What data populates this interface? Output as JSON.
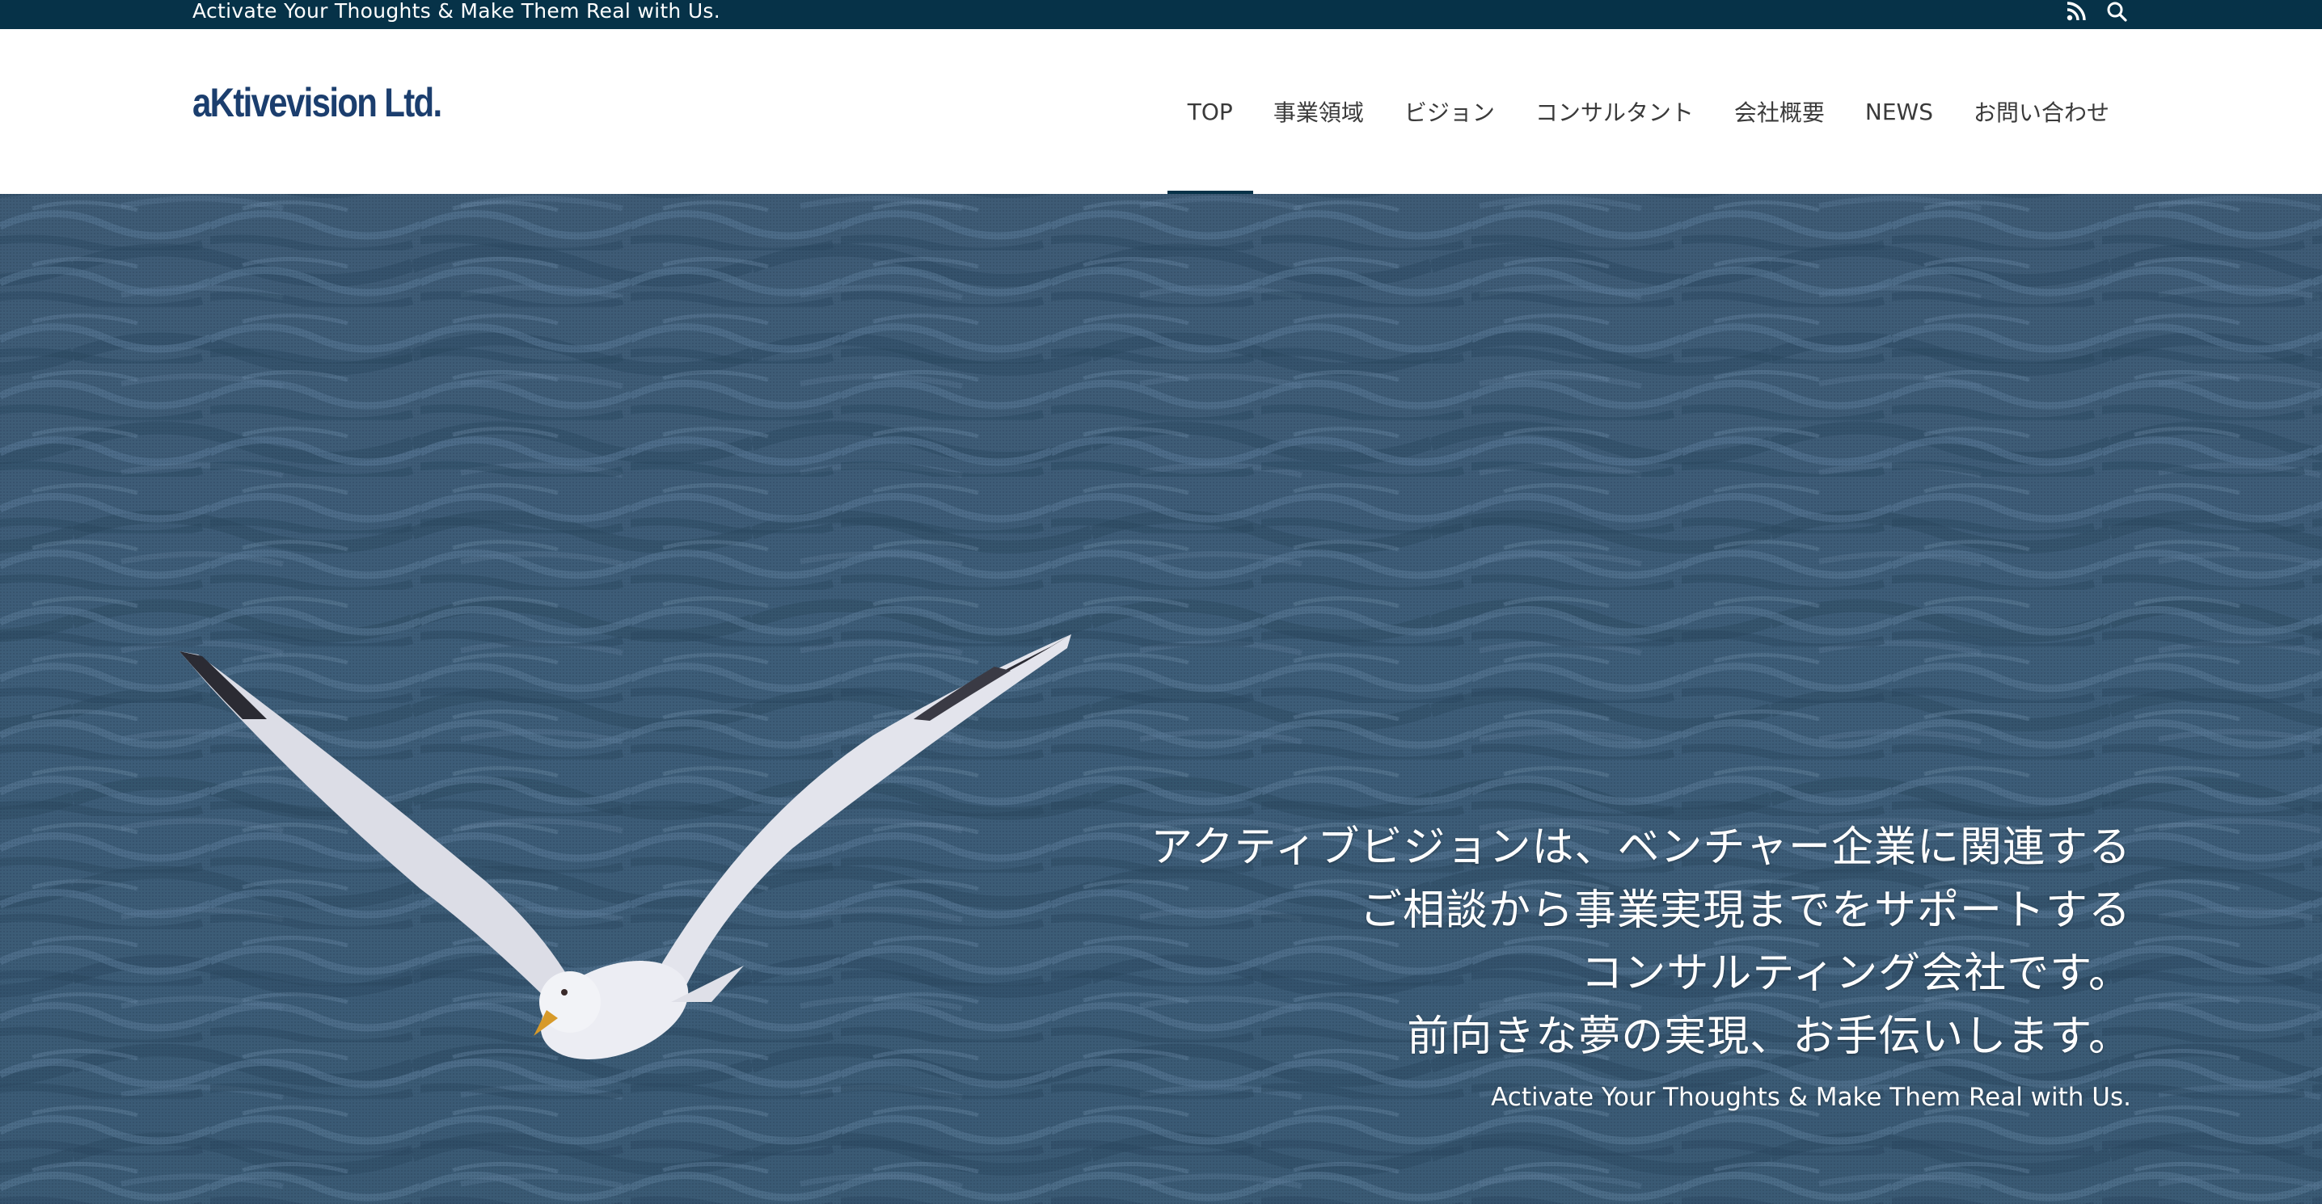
{
  "topbar": {
    "tagline": "Activate Your Thoughts & Make Them Real with Us.",
    "icons": [
      "rss-icon",
      "search-icon"
    ]
  },
  "header": {
    "logo": "aKtivevision Ltd.",
    "nav": [
      {
        "label": "TOP",
        "active": true
      },
      {
        "label": "事業領域"
      },
      {
        "label": "ビジョン"
      },
      {
        "label": "コンサルタント"
      },
      {
        "label": "会社概要"
      },
      {
        "label": "NEWS"
      },
      {
        "label": "お問い合わせ"
      }
    ]
  },
  "hero": {
    "lines": [
      "アクティブビジョンは、ベンチャー企業に関連する",
      "ご相談から事業実現までをサポートする",
      "コンサルティング会社です。",
      "前向きな夢の実現、お手伝いします。"
    ],
    "subline": "Activate Your Thoughts & Make Them Real with Us."
  },
  "colors": {
    "topbar": "#063248",
    "logo": "#1b3e6e",
    "nav_text": "#3a3a3a",
    "sea": "#3d5d78"
  }
}
